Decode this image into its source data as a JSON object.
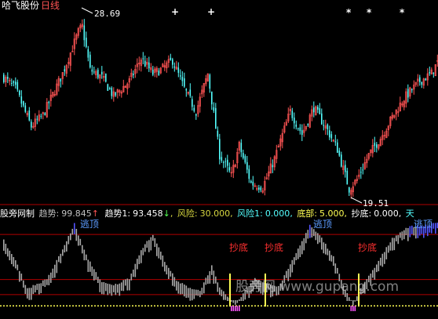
{
  "colors": {
    "up": "#ff5454",
    "down": "#54ffff",
    "white": "#ffffff",
    "gray_bar": "#a8a8a8",
    "bottom_bar": "#ff54ff",
    "signal_bar": "#ffff54",
    "top_bar": "#5454ff",
    "dotted": "#ffff54",
    "green": "#54ff54",
    "text_up": "#ff5454",
    "text_dn": "#54ffff",
    "blue_text": "#5c9cff",
    "label_gray": "#c0c0c0",
    "separator": "#b00000",
    "legend_gold": "#d8d840"
  },
  "header": {
    "stock_name": "哈飞股份",
    "period": "日线"
  },
  "annotations": {
    "high_label": "28.69",
    "low_label": "19.51",
    "signal_marks": [
      "+",
      "+",
      "*",
      "*",
      "*"
    ]
  },
  "legend": {
    "panel_name": "股旁网制",
    "trend_label": "趋势:",
    "trend_value": "99.845",
    "trend_arrow": "↑",
    "trend1_label": "趋势1:",
    "trend1_value": "93.458",
    "trend1_arrow": "↓",
    "risk_label": "风险:",
    "risk_value": "30.000",
    "risk1_label": "风险1:",
    "risk1_value": "0.000",
    "bottom_label": "底部:",
    "bottom_value": "5.000",
    "chaodi_label": "抄底:",
    "chaodi_value": "0.000",
    "tail": "天"
  },
  "signals": {
    "escape_top": "逃顶",
    "buy_bottom": "抄底"
  },
  "watermark": "股旁网 www.gupang.com",
  "chart_data": [
    {
      "type": "candlestick",
      "panel": "price",
      "max_marker": 28.69,
      "min_marker": 19.51,
      "ylim": [
        19.0,
        29.2
      ],
      "key_points": [
        {
          "i": 0,
          "close": 25.6
        },
        {
          "i": 6,
          "close": 25.0
        },
        {
          "i": 14,
          "close": 23.0
        },
        {
          "i": 20,
          "close": 23.6
        },
        {
          "i": 30,
          "close": 25.8
        },
        {
          "i": 38,
          "close": 28.0
        },
        {
          "i": 40,
          "close": 28.3
        },
        {
          "i": 44,
          "close": 26.0
        },
        {
          "i": 50,
          "close": 25.6
        },
        {
          "i": 56,
          "close": 24.6
        },
        {
          "i": 64,
          "close": 25.4
        },
        {
          "i": 70,
          "close": 26.6
        },
        {
          "i": 76,
          "close": 25.8
        },
        {
          "i": 80,
          "close": 26.0
        },
        {
          "i": 86,
          "close": 26.5
        },
        {
          "i": 92,
          "close": 25.0
        },
        {
          "i": 98,
          "close": 23.8
        },
        {
          "i": 104,
          "close": 25.8
        },
        {
          "i": 110,
          "close": 21.5
        },
        {
          "i": 116,
          "close": 20.4
        },
        {
          "i": 120,
          "close": 22.0
        },
        {
          "i": 126,
          "close": 20.0
        },
        {
          "i": 132,
          "close": 19.8
        },
        {
          "i": 138,
          "close": 21.3
        },
        {
          "i": 146,
          "close": 23.8
        },
        {
          "i": 152,
          "close": 22.6
        },
        {
          "i": 158,
          "close": 24.0
        },
        {
          "i": 165,
          "close": 22.8
        },
        {
          "i": 170,
          "close": 21.8
        },
        {
          "i": 176,
          "close": 19.7
        },
        {
          "i": 180,
          "close": 20.2
        },
        {
          "i": 186,
          "close": 21.5
        },
        {
          "i": 192,
          "close": 22.4
        },
        {
          "i": 198,
          "close": 23.5
        },
        {
          "i": 204,
          "close": 24.5
        },
        {
          "i": 212,
          "close": 25.4
        },
        {
          "i": 218,
          "close": 25.8
        },
        {
          "i": 221,
          "close": 26.4
        }
      ]
    },
    {
      "type": "bar",
      "panel": "indicator",
      "series_name": "趋势",
      "ylim": [
        -10,
        110
      ],
      "reference_lines": [
        -5,
        10,
        30,
        90
      ],
      "key_points": [
        {
          "i": 0,
          "v": 82
        },
        {
          "i": 6,
          "v": 55
        },
        {
          "i": 12,
          "v": 18
        },
        {
          "i": 22,
          "v": 30
        },
        {
          "i": 30,
          "v": 70
        },
        {
          "i": 36,
          "v": 104
        },
        {
          "i": 42,
          "v": 62
        },
        {
          "i": 50,
          "v": 26
        },
        {
          "i": 56,
          "v": 22
        },
        {
          "i": 64,
          "v": 32
        },
        {
          "i": 70,
          "v": 70
        },
        {
          "i": 76,
          "v": 90
        },
        {
          "i": 82,
          "v": 55
        },
        {
          "i": 88,
          "v": 28
        },
        {
          "i": 94,
          "v": 20
        },
        {
          "i": 100,
          "v": 15
        },
        {
          "i": 106,
          "v": 48
        },
        {
          "i": 110,
          "v": 18
        },
        {
          "i": 114,
          "v": 8
        },
        {
          "i": 118,
          "v": -4
        },
        {
          "i": 122,
          "v": 12
        },
        {
          "i": 128,
          "v": 32
        },
        {
          "i": 134,
          "v": 25
        },
        {
          "i": 140,
          "v": 20
        },
        {
          "i": 148,
          "v": 60
        },
        {
          "i": 156,
          "v": 102
        },
        {
          "i": 162,
          "v": 85
        },
        {
          "i": 168,
          "v": 60
        },
        {
          "i": 174,
          "v": 15
        },
        {
          "i": 178,
          "v": -2
        },
        {
          "i": 182,
          "v": 18
        },
        {
          "i": 190,
          "v": 50
        },
        {
          "i": 198,
          "v": 85
        },
        {
          "i": 206,
          "v": 100
        },
        {
          "i": 214,
          "v": 102
        },
        {
          "i": 221,
          "v": 105
        }
      ]
    }
  ]
}
